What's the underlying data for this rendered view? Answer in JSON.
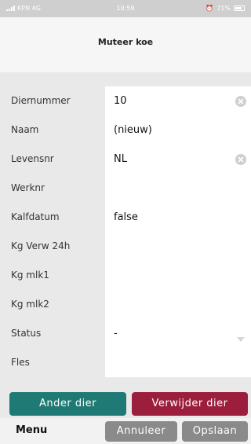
{
  "status_bar": {
    "carrier": "KPN 4G",
    "time": "10:59",
    "battery": "71%"
  },
  "header": {
    "title": "Muteer koe"
  },
  "form": {
    "rows": [
      {
        "label": "Diernummer",
        "value": "10",
        "clearable": true
      },
      {
        "label": "Naam",
        "value": "(nieuw)",
        "clearable": false
      },
      {
        "label": "Levensnr",
        "value": "NL",
        "clearable": true
      },
      {
        "label": "Werknr",
        "value": "",
        "clearable": false
      },
      {
        "label": "Kalfdatum",
        "value": "false",
        "clearable": false
      },
      {
        "label": "Kg Verw 24h",
        "value": "",
        "clearable": false
      },
      {
        "label": "Kg mlk1",
        "value": "",
        "clearable": false
      },
      {
        "label": "Kg mlk2",
        "value": "",
        "clearable": false
      },
      {
        "label": "Status",
        "value": "-",
        "clearable": false
      },
      {
        "label": "Fles",
        "value": "",
        "clearable": false
      }
    ]
  },
  "actions": {
    "other_animal": "Ander dier",
    "delete_animal": "Verwijder dier"
  },
  "bottom": {
    "menu": "Menu",
    "cancel": "Annuleer",
    "save": "Opslaan"
  },
  "colors": {
    "teal": "#1f7a75",
    "crimson": "#9b1f3c",
    "gray_button": "#8a8a8a"
  }
}
